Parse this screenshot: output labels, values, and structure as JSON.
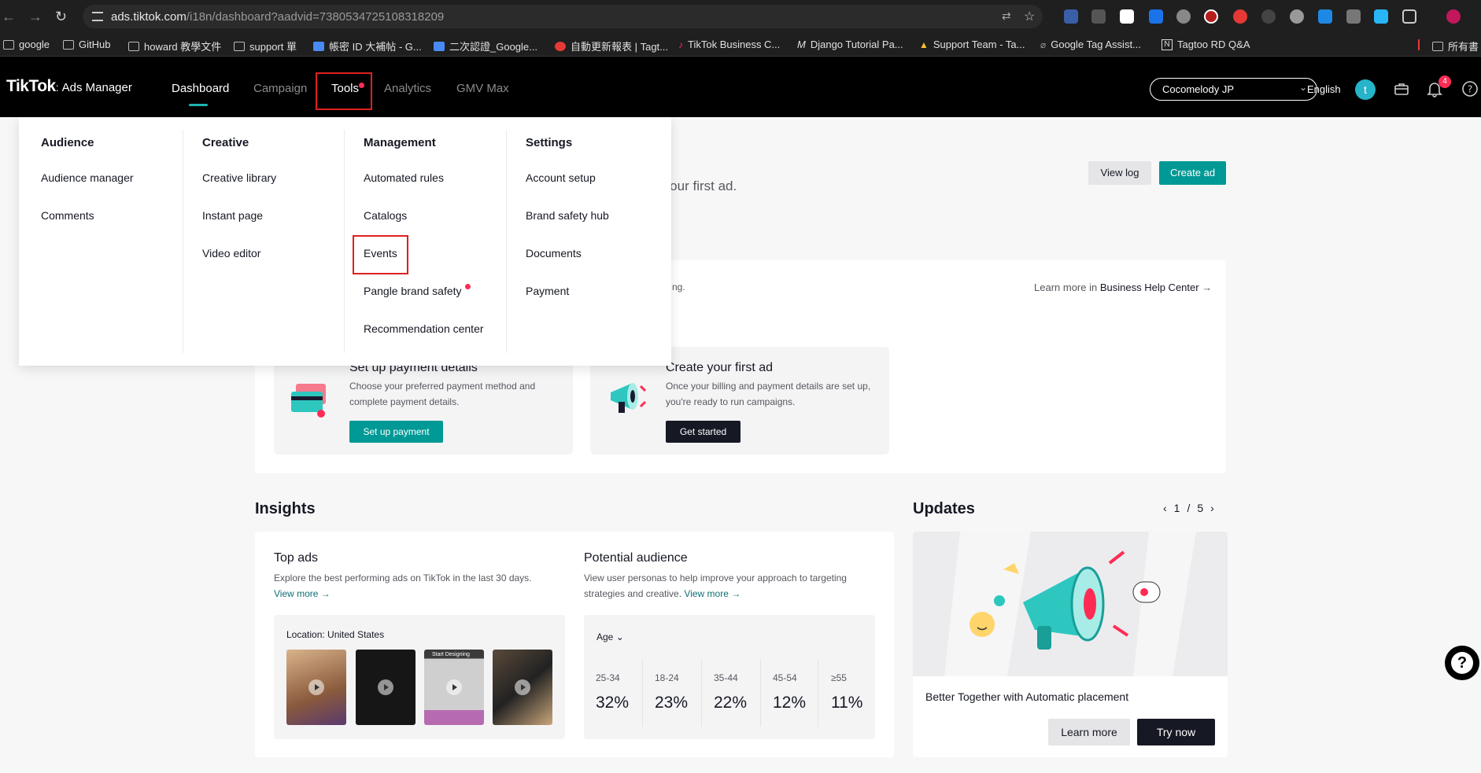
{
  "browser": {
    "url_host": "ads.tiktok.com",
    "url_path": "/i18n/dashboard?aadvid=7380534725108318209",
    "bookmarks": [
      {
        "label": "google",
        "icon": "folder-icon"
      },
      {
        "label": "GitHub",
        "icon": "folder-icon"
      },
      {
        "label": "howard 教學文件",
        "icon": "folder-icon"
      },
      {
        "label": "support 單",
        "icon": "folder-icon"
      },
      {
        "label": "帳密 ID 大補帖 - G...",
        "icon": "doc-icon"
      },
      {
        "label": "二次認證_Google...",
        "icon": "doc-icon"
      },
      {
        "label": "自動更新報表 | Tagt...",
        "icon": "target-icon"
      },
      {
        "label": "TikTok Business C...",
        "icon": "tiktok-icon"
      },
      {
        "label": "Django Tutorial Pa...",
        "icon": "m-icon"
      },
      {
        "label": "Support Team - Ta...",
        "icon": "drive-icon"
      },
      {
        "label": "Google Tag Assist...",
        "icon": "tag-icon"
      },
      {
        "label": "Tagtoo RD Q&A",
        "icon": "notion-icon"
      },
      {
        "label": "所有書",
        "icon": "folder-icon"
      }
    ]
  },
  "header": {
    "logo_brand": "TikTok",
    "logo_product": "Ads Manager",
    "nav": [
      {
        "label": "Dashboard",
        "active": true
      },
      {
        "label": "Campaign",
        "active": false
      },
      {
        "label": "Tools",
        "active": false
      },
      {
        "label": "Analytics",
        "active": false
      },
      {
        "label": "GMV Max",
        "active": false
      }
    ],
    "account": "Cocomelody JP",
    "language": "English",
    "avatar_letter": "t",
    "notification_count": "4"
  },
  "tools_menu": {
    "audience": {
      "title": "Audience",
      "items": [
        "Audience manager",
        "Comments"
      ]
    },
    "creative": {
      "title": "Creative",
      "items": [
        "Creative library",
        "Instant page",
        "Video editor"
      ]
    },
    "management": {
      "title": "Management",
      "items": [
        "Automated rules",
        "Catalogs",
        "Events",
        "Pangle brand safety",
        "Recommendation center"
      ]
    },
    "settings": {
      "title": "Settings",
      "items": [
        "Account setup",
        "Brand safety hub",
        "Documents",
        "Payment"
      ]
    }
  },
  "dashboard": {
    "welcome_fragment": "sh your first ad.",
    "view_log": "View log",
    "create_ad": "Create ad",
    "setup_fragment": "ng.",
    "learn_more_prefix": "Learn more in",
    "help_center": "Business Help Center",
    "payment_card": {
      "title": "Set up payment details",
      "desc": "Choose your preferred payment method and complete payment details.",
      "button": "Set up payment"
    },
    "first_ad_card": {
      "title": "Create your first ad",
      "desc": "Once your billing and payment details are set up, you're ready to run campaigns.",
      "button": "Get started"
    },
    "insights": {
      "title": "Insights",
      "top_ads": {
        "title": "Top ads",
        "desc": "Explore the best performing ads on TikTok in the last 30 days.",
        "view_more": "View more",
        "location": "Location: United States",
        "thumb_caption": "Start Designing"
      },
      "potential_audience": {
        "title": "Potential audience",
        "desc": "View user personas to help improve your approach to targeting strategies and creative.",
        "view_more": "View more",
        "filter": "Age",
        "ages": [
          {
            "range": "25-34",
            "pct": "32%"
          },
          {
            "range": "18-24",
            "pct": "23%"
          },
          {
            "range": "35-44",
            "pct": "22%"
          },
          {
            "range": "45-54",
            "pct": "12%"
          },
          {
            "range": "≥55",
            "pct": "11%"
          }
        ]
      }
    },
    "updates": {
      "title": "Updates",
      "page": "1",
      "total": "5",
      "separator": "/",
      "card_title": "Better Together with Automatic placement",
      "learn_more": "Learn more",
      "try_now": "Try now"
    }
  },
  "colors": {
    "teal": "#009995",
    "highlight_red": "#e02020",
    "tiktok_red": "#fe2c55"
  }
}
